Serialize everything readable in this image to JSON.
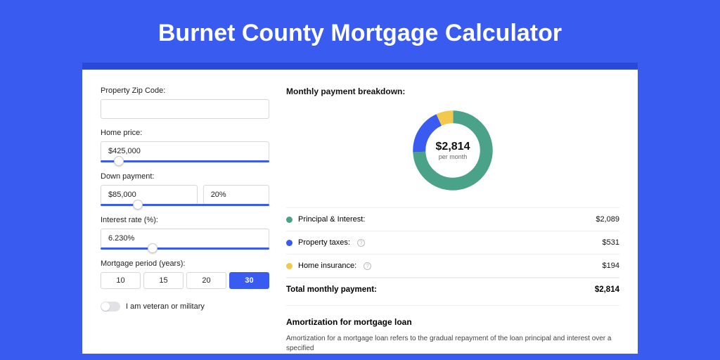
{
  "title": "Burnet County Mortgage Calculator",
  "form": {
    "zip_label": "Property Zip Code:",
    "zip_value": "",
    "home_price_label": "Home price:",
    "home_price_value": "$425,000",
    "down_payment_label": "Down payment:",
    "down_payment_amount": "$85,000",
    "down_payment_pct": "20%",
    "interest_label": "Interest rate (%):",
    "interest_value": "6.230%",
    "period_label": "Mortgage period (years):",
    "periods": [
      "10",
      "15",
      "20",
      "30"
    ],
    "period_active": "30",
    "veteran_label": "I am veteran or military"
  },
  "breakdown": {
    "heading": "Monthly payment breakdown:",
    "center_value": "$2,814",
    "center_sub": "per month",
    "rows": [
      {
        "label": "Principal & Interest:",
        "value": "$2,089",
        "color": "green",
        "info": false
      },
      {
        "label": "Property taxes:",
        "value": "$531",
        "color": "blue",
        "info": true
      },
      {
        "label": "Home insurance:",
        "value": "$194",
        "color": "yellow",
        "info": true
      }
    ],
    "total_label": "Total monthly payment:",
    "total_value": "$2,814"
  },
  "amort": {
    "heading": "Amortization for mortgage loan",
    "text": "Amortization for a mortgage loan refers to the gradual repayment of the loan principal and interest over a specified"
  },
  "chart_data": {
    "type": "pie",
    "title": "Monthly payment breakdown",
    "series": [
      {
        "name": "Principal & Interest",
        "value": 2089,
        "color": "#4aa389"
      },
      {
        "name": "Property taxes",
        "value": 531,
        "color": "#3a5bef"
      },
      {
        "name": "Home insurance",
        "value": 194,
        "color": "#f2c94c"
      }
    ],
    "total": 2814
  }
}
